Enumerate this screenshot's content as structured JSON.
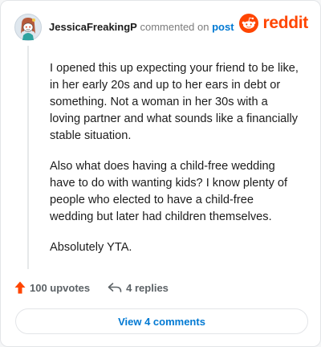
{
  "header": {
    "username": "JessicaFreakingP",
    "action": "commented on",
    "post_link": "post",
    "logo_text": "reddit"
  },
  "comment": {
    "paragraphs": [
      "I opened this up expecting your friend to be like, in her early 20s and up to her ears in debt or something. Not a woman in her 30s with a loving partner and what sounds like a financially stable situation.",
      "Also what does having a child-free wedding have to do with wanting kids? I know plenty of people who elected to have a child-free wedding but later had children themselves.",
      "Absolutely YTA."
    ]
  },
  "footer": {
    "upvotes": "100 upvotes",
    "replies": "4 replies",
    "view_comments": "View 4 comments"
  },
  "colors": {
    "brand": "#ff4500",
    "link": "#0079d3"
  },
  "icons": {
    "avatar": "snoo-avatar",
    "logo": "reddit-snoo-icon",
    "upvote": "upvote-arrow-icon",
    "reply": "reply-arrow-icon"
  }
}
